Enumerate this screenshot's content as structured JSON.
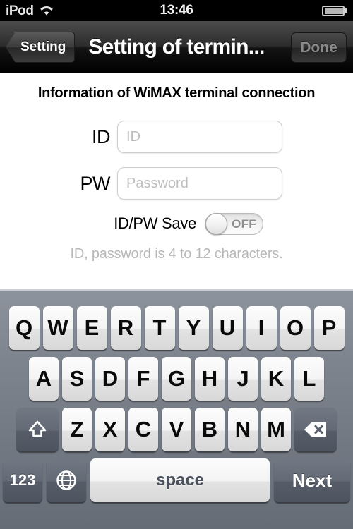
{
  "status_bar": {
    "carrier": "iPod",
    "wifi_icon": "wifi-icon",
    "time": "13:46",
    "battery_icon": "battery-icon"
  },
  "nav_bar": {
    "back_label": "Setting",
    "title": "Setting of termin...",
    "done_label": "Done",
    "done_enabled": false
  },
  "form": {
    "heading": "Information of WiMAX terminal connection",
    "fields": [
      {
        "label": "ID",
        "value": "",
        "placeholder": "ID"
      },
      {
        "label": "PW",
        "value": "",
        "placeholder": "Password"
      }
    ],
    "toggle": {
      "label": "ID/PW Save",
      "state": "OFF"
    },
    "hint": "ID, password is 4 to 12 characters."
  },
  "keyboard": {
    "row1": [
      "Q",
      "W",
      "E",
      "R",
      "T",
      "Y",
      "U",
      "I",
      "O",
      "P"
    ],
    "row2": [
      "A",
      "S",
      "D",
      "F",
      "G",
      "H",
      "J",
      "K",
      "L"
    ],
    "row3_letters": [
      "Z",
      "X",
      "C",
      "V",
      "B",
      "N",
      "M"
    ],
    "shift_icon": "shift-icon",
    "backspace_icon": "backspace-icon",
    "numeric_label": "123",
    "globe_icon": "globe-icon",
    "space_label": "space",
    "return_label": "Next"
  },
  "colors": {
    "keyboard_background": "#7d848e",
    "key_light": "#f3f3f3",
    "key_dark": "#636a75",
    "navbar": "#2c2c2c",
    "hint_text": "#b8b8b8",
    "placeholder": "#bdbdbd"
  }
}
